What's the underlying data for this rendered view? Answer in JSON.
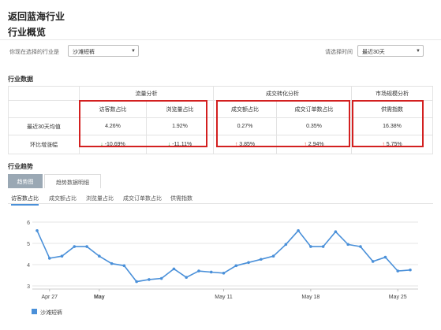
{
  "header": {
    "back_title": "返回蓝海行业",
    "overview_title": "行业概览"
  },
  "filters": {
    "industry_label": "你现在选择的行业是",
    "industry_value": "沙滩短裤",
    "time_label": "请选择时间",
    "time_value": "最近30天"
  },
  "industry_data": {
    "section_title": "行业数据",
    "groups": [
      "流量分析",
      "成交转化分析",
      "市场规模分析"
    ],
    "columns": [
      "访客数占比",
      "浏览量占比",
      "成交额占比",
      "成交订单数占比",
      "供需指数"
    ],
    "rows": [
      {
        "label": "最近30天均值",
        "values": [
          "4.26%",
          "1.92%",
          "0.27%",
          "0.35%",
          "16.38%"
        ]
      },
      {
        "label": "环比增涨幅",
        "values": [
          "-10.69%",
          "-11.11%",
          "3.85%",
          "2.94%",
          "5.75%"
        ],
        "directions": [
          "down",
          "down",
          "up",
          "up",
          "up"
        ]
      }
    ],
    "arrow_up": "↑",
    "arrow_down": "↓"
  },
  "trend": {
    "section_title": "行业趋势",
    "tabs": [
      "趋势图",
      "趋势数据明细"
    ],
    "active_tab": 0,
    "subtabs": [
      "访客数占比",
      "成交额占比",
      "浏览量占比",
      "成交订单数占比",
      "供需指数"
    ],
    "active_subtab": 0
  },
  "chart_data": {
    "type": "line",
    "title": "",
    "xlabel": "",
    "ylabel": "",
    "ylim": [
      3,
      6
    ],
    "yticks": [
      "3",
      "4",
      "5",
      "6"
    ],
    "xtick_labels": [
      {
        "index": 1,
        "label": "Apr 27",
        "bold": false
      },
      {
        "index": 5,
        "label": "May",
        "bold": true
      },
      {
        "index": 15,
        "label": "May 11",
        "bold": false
      },
      {
        "index": 22,
        "label": "May 18",
        "bold": false
      },
      {
        "index": 29,
        "label": "May 25",
        "bold": false
      }
    ],
    "series": [
      {
        "name": "沙滩短裤",
        "color": "#4a90d9",
        "values": [
          5.6,
          4.3,
          4.4,
          4.85,
          4.85,
          4.4,
          4.05,
          3.95,
          3.2,
          3.3,
          3.35,
          3.8,
          3.4,
          3.7,
          3.65,
          3.6,
          3.95,
          4.1,
          4.25,
          4.4,
          4.95,
          5.6,
          4.85,
          4.85,
          5.55,
          4.95,
          4.85,
          4.15,
          4.35,
          3.7,
          3.75
        ]
      }
    ],
    "grid": true,
    "legend_position": "bottom-left"
  }
}
